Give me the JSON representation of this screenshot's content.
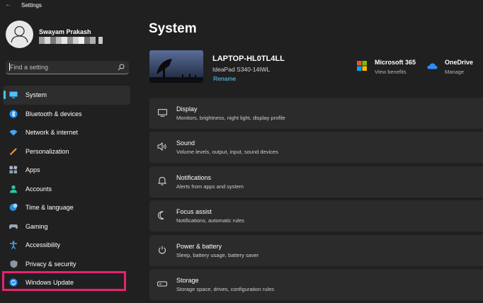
{
  "window": {
    "title": "Settings"
  },
  "user": {
    "name": "Swayam Prakash"
  },
  "search": {
    "placeholder": "Find a setting"
  },
  "nav": [
    {
      "label": "System",
      "icon": "monitor-icon",
      "active": true
    },
    {
      "label": "Bluetooth & devices",
      "icon": "bluetooth-icon"
    },
    {
      "label": "Network & internet",
      "icon": "wifi-icon"
    },
    {
      "label": "Personalization",
      "icon": "brush-icon"
    },
    {
      "label": "Apps",
      "icon": "apps-icon"
    },
    {
      "label": "Accounts",
      "icon": "person-icon"
    },
    {
      "label": "Time & language",
      "icon": "globe-clock-icon"
    },
    {
      "label": "Gaming",
      "icon": "gamepad-icon"
    },
    {
      "label": "Accessibility",
      "icon": "accessibility-icon"
    },
    {
      "label": "Privacy & security",
      "icon": "shield-icon"
    },
    {
      "label": "Windows Update",
      "icon": "refresh-icon"
    }
  ],
  "page": {
    "title": "System"
  },
  "device": {
    "name": "LAPTOP-HL0TL4LL",
    "model": "IdeaPad S340-14IWL",
    "rename": "Rename"
  },
  "services": {
    "microsoft365": {
      "title": "Microsoft 365",
      "sub": "View benefits"
    },
    "onedrive": {
      "title": "OneDrive",
      "sub": "Manage"
    }
  },
  "cards": [
    {
      "title": "Display",
      "desc": "Monitors, brightness, night light, display profile",
      "icon": "display-icon"
    },
    {
      "title": "Sound",
      "desc": "Volume levels, output, input, sound devices",
      "icon": "speaker-icon"
    },
    {
      "title": "Notifications",
      "desc": "Alerts from apps and system",
      "icon": "bell-icon"
    },
    {
      "title": "Focus assist",
      "desc": "Notifications, automatic rules",
      "icon": "moon-icon"
    },
    {
      "title": "Power & battery",
      "desc": "Sleep, battery usage, battery saver",
      "icon": "power-icon"
    },
    {
      "title": "Storage",
      "desc": "Storage space, drives, configuration rules",
      "icon": "storage-icon"
    }
  ],
  "colors": {
    "accent": "#4cc2ff",
    "link": "#60cdff",
    "highlight": "#e5236e",
    "background": "#202020",
    "card": "#2b2b2b"
  }
}
